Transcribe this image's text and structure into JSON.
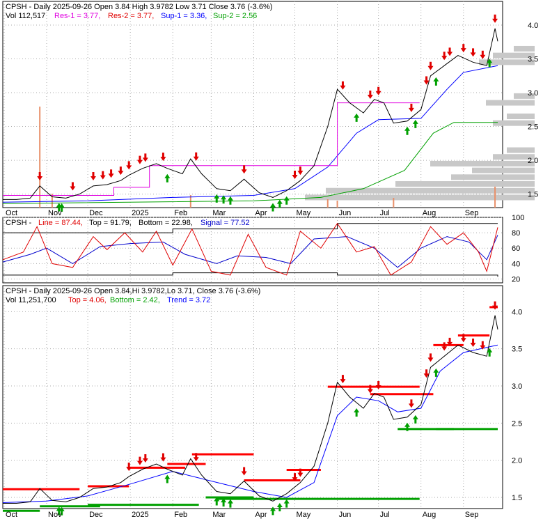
{
  "chart_data": [
    {
      "type": "candlestick",
      "symbol": "CPSH",
      "header": {
        "title": "CPSH - Daily 2025-09-26 Open 3.84  High 3.9782  Low 3.71  Close 3.76 (-3.6%)",
        "vol": "Vol 112,517",
        "res1": "Res-1 = 3.77,",
        "res2": "Res-2 = 3.77,",
        "sup1": "Sup-1 = 3.36,",
        "sup2": "Sup-2 = 2.56"
      },
      "ylim": [
        1.3,
        4.35
      ],
      "yticks": [
        "1.5",
        "2.0",
        "2.5",
        "3.0",
        "3.5",
        "4.0"
      ],
      "months": [
        "Oct",
        "Nov",
        "Dec",
        "2025",
        "Feb",
        "Mar",
        "Apr",
        "May",
        "Jun",
        "Jul",
        "Aug",
        "Sep"
      ],
      "close_path": [
        [
          "2024-09-30",
          1.42
        ],
        [
          "2024-10-10",
          1.42
        ],
        [
          "2024-10-20",
          1.44
        ],
        [
          "2024-10-27",
          1.62
        ],
        [
          "2024-11-05",
          1.46
        ],
        [
          "2024-11-15",
          1.44
        ],
        [
          "2024-11-25",
          1.5
        ],
        [
          "2024-12-05",
          1.62
        ],
        [
          "2024-12-15",
          1.64
        ],
        [
          "2024-12-25",
          1.7
        ],
        [
          "2024-12-31",
          1.78
        ],
        [
          "2025-01-10",
          1.88
        ],
        [
          "2025-01-20",
          1.95
        ],
        [
          "2025-01-28",
          1.88
        ],
        [
          "2025-02-08",
          1.8
        ],
        [
          "2025-02-14",
          2.02
        ],
        [
          "2025-02-22",
          1.8
        ],
        [
          "2025-03-05",
          1.58
        ],
        [
          "2025-03-15",
          1.55
        ],
        [
          "2025-03-25",
          1.72
        ],
        [
          "2025-04-05",
          1.52
        ],
        [
          "2025-04-15",
          1.45
        ],
        [
          "2025-04-25",
          1.55
        ],
        [
          "2025-05-05",
          1.7
        ],
        [
          "2025-05-15",
          1.92
        ],
        [
          "2025-05-25",
          2.5
        ],
        [
          "2025-06-01",
          3.05
        ],
        [
          "2025-06-10",
          2.85
        ],
        [
          "2025-06-20",
          2.7
        ],
        [
          "2025-06-28",
          2.9
        ],
        [
          "2025-07-05",
          2.85
        ],
        [
          "2025-07-12",
          2.55
        ],
        [
          "2025-07-22",
          2.58
        ],
        [
          "2025-08-01",
          2.75
        ],
        [
          "2025-08-08",
          3.25
        ],
        [
          "2025-08-18",
          3.4
        ],
        [
          "2025-08-28",
          3.55
        ],
        [
          "2025-09-08",
          3.45
        ],
        [
          "2025-09-18",
          3.4
        ],
        [
          "2025-09-24",
          3.95
        ],
        [
          "2025-09-26",
          3.76
        ]
      ],
      "ma_fast": [
        [
          "2024-09-30",
          1.43
        ],
        [
          "2024-11-01",
          1.45
        ],
        [
          "2024-12-01",
          1.52
        ],
        [
          "2025-01-01",
          1.68
        ],
        [
          "2025-02-01",
          1.85
        ],
        [
          "2025-03-01",
          1.72
        ],
        [
          "2025-04-01",
          1.58
        ],
        [
          "2025-04-25",
          1.5
        ],
        [
          "2025-05-15",
          1.7
        ],
        [
          "2025-06-01",
          2.6
        ],
        [
          "2025-06-15",
          2.85
        ],
        [
          "2025-07-01",
          2.8
        ],
        [
          "2025-07-15",
          2.65
        ],
        [
          "2025-08-01",
          2.7
        ],
        [
          "2025-08-15",
          3.2
        ],
        [
          "2025-09-01",
          3.45
        ],
        [
          "2025-09-26",
          3.55
        ]
      ],
      "ma_slow": [
        [
          "2024-09-30",
          1.38
        ],
        [
          "2024-12-01",
          1.4
        ],
        [
          "2025-02-01",
          1.45
        ],
        [
          "2025-04-01",
          1.48
        ],
        [
          "2025-05-01",
          1.58
        ],
        [
          "2025-05-25",
          1.9
        ],
        [
          "2025-06-15",
          2.4
        ],
        [
          "2025-07-01",
          2.6
        ],
        [
          "2025-08-01",
          2.62
        ],
        [
          "2025-08-20",
          3.05
        ],
        [
          "2025-09-01",
          3.3
        ],
        [
          "2025-09-26",
          3.4
        ]
      ],
      "ma_long": [
        [
          "2024-09-30",
          1.36
        ],
        [
          "2025-04-01",
          1.4
        ],
        [
          "2025-05-20",
          1.45
        ],
        [
          "2025-06-20",
          1.58
        ],
        [
          "2025-07-20",
          1.85
        ],
        [
          "2025-08-10",
          2.4
        ],
        [
          "2025-08-25",
          2.56
        ],
        [
          "2025-09-26",
          2.56
        ]
      ],
      "res_steps": [
        [
          "2024-09-30",
          1.48
        ],
        [
          "2024-11-20",
          1.48
        ],
        [
          "2024-12-20",
          1.6
        ],
        [
          "2025-01-15",
          1.92
        ],
        [
          "2025-03-01",
          1.92
        ],
        [
          "2025-03-15",
          1.92
        ],
        [
          "2025-05-01",
          1.92
        ],
        [
          "2025-06-01",
          2.85
        ],
        [
          "2025-07-31",
          2.85
        ]
      ],
      "volume_spike_dates": [
        "2024-10-27",
        "2024-11-05",
        "2025-02-14",
        "2025-05-25",
        "2025-06-01",
        "2025-07-12",
        "2025-09-24"
      ],
      "red_arrow_dates": [
        "2024-10-27",
        "2024-11-20",
        "2024-12-05",
        "2024-12-12",
        "2024-12-18",
        "2024-12-25",
        "2024-12-31",
        "2025-01-08",
        "2025-01-12",
        "2025-01-25",
        "2025-02-18",
        "2025-03-25",
        "2025-05-01",
        "2025-05-05",
        "2025-06-05",
        "2025-06-25",
        "2025-07-01",
        "2025-07-25",
        "2025-08-05",
        "2025-08-08",
        "2025-08-18",
        "2025-08-22",
        "2025-09-01",
        "2025-09-08",
        "2025-09-15",
        "2025-09-24"
      ],
      "green_arrow_dates": [
        "2024-11-10",
        "2024-11-12",
        "2025-01-28",
        "2025-03-05",
        "2025-03-10",
        "2025-03-15",
        "2025-04-15",
        "2025-04-20",
        "2025-04-25",
        "2025-06-15",
        "2025-07-22",
        "2025-07-28",
        "2025-08-12",
        "2025-09-20"
      ]
    },
    {
      "type": "line",
      "header": {
        "title": "CPSH -",
        "line": "Line = 87.44,",
        "top": "Top = 91.79,",
        "bottom": "Bottom = 22.98,",
        "signal": "Signal = 77.52"
      },
      "ylim": [
        15,
        100
      ],
      "yticks": [
        "20",
        "40",
        "60",
        "80",
        "100"
      ],
      "line": [
        [
          "2024-09-30",
          45
        ],
        [
          "2024-10-15",
          55
        ],
        [
          "2024-10-25",
          88
        ],
        [
          "2024-11-05",
          40
        ],
        [
          "2024-11-20",
          35
        ],
        [
          "2024-12-05",
          75
        ],
        [
          "2024-12-15",
          58
        ],
        [
          "2024-12-28",
          80
        ],
        [
          "2025-01-10",
          55
        ],
        [
          "2025-01-20",
          82
        ],
        [
          "2025-02-01",
          38
        ],
        [
          "2025-02-15",
          85
        ],
        [
          "2025-03-01",
          30
        ],
        [
          "2025-03-15",
          25
        ],
        [
          "2025-03-28",
          78
        ],
        [
          "2025-04-10",
          35
        ],
        [
          "2025-04-25",
          25
        ],
        [
          "2025-05-05",
          82
        ],
        [
          "2025-05-20",
          60
        ],
        [
          "2025-06-01",
          92
        ],
        [
          "2025-06-15",
          55
        ],
        [
          "2025-06-28",
          62
        ],
        [
          "2025-07-10",
          25
        ],
        [
          "2025-07-25",
          42
        ],
        [
          "2025-08-08",
          88
        ],
        [
          "2025-08-20",
          65
        ],
        [
          "2025-09-01",
          80
        ],
        [
          "2025-09-12",
          55
        ],
        [
          "2025-09-18",
          30
        ],
        [
          "2025-09-26",
          87
        ]
      ],
      "signal": [
        [
          "2024-09-30",
          42
        ],
        [
          "2024-10-20",
          52
        ],
        [
          "2024-11-01",
          60
        ],
        [
          "2024-11-20",
          40
        ],
        [
          "2024-12-10",
          62
        ],
        [
          "2025-01-01",
          66
        ],
        [
          "2025-01-25",
          68
        ],
        [
          "2025-02-10",
          52
        ],
        [
          "2025-03-05",
          40
        ],
        [
          "2025-03-20",
          50
        ],
        [
          "2025-04-10",
          48
        ],
        [
          "2025-04-28",
          40
        ],
        [
          "2025-05-15",
          72
        ],
        [
          "2025-06-08",
          75
        ],
        [
          "2025-06-28",
          60
        ],
        [
          "2025-07-15",
          35
        ],
        [
          "2025-08-01",
          60
        ],
        [
          "2025-08-20",
          75
        ],
        [
          "2025-09-05",
          68
        ],
        [
          "2025-09-18",
          45
        ],
        [
          "2025-09-26",
          77
        ]
      ],
      "top_band": [
        [
          "2024-09-30",
          80
        ],
        [
          "2025-02-01",
          85
        ],
        [
          "2025-06-01",
          92
        ],
        [
          "2025-09-26",
          92
        ]
      ],
      "bottom_band": [
        [
          "2024-09-30",
          25
        ],
        [
          "2025-02-01",
          28
        ],
        [
          "2025-06-01",
          25
        ],
        [
          "2025-09-26",
          23
        ]
      ]
    },
    {
      "type": "candlestick",
      "header": {
        "title": "CPSH - Daily 2025-09-26 Open 3.84,Hi 3.9782,Lo 3.71, Close 3.76 (-3.6%)",
        "vol": "Vol 11,251,700",
        "top": "Top = 4.06,",
        "bottom": "Bottom = 2.42,",
        "trend": "Trend = 3.72"
      },
      "ylim": [
        1.35,
        4.35
      ],
      "yticks": [
        "1.5",
        "2.0",
        "2.5",
        "3.0",
        "3.5",
        "4.0"
      ],
      "months": [
        "Oct",
        "Nov",
        "Dec",
        "2025",
        "Feb",
        "Mar",
        "Apr",
        "May",
        "Jun",
        "Jul",
        "Aug",
        "Sep"
      ],
      "red_levels": [
        [
          "2024-09-30",
          "2024-11-25",
          1.61
        ],
        [
          "2024-12-01",
          "2024-12-31",
          1.65
        ],
        [
          "2024-12-31",
          "2025-02-10",
          1.9
        ],
        [
          "2025-01-28",
          "2025-02-25",
          1.95
        ],
        [
          "2025-02-15",
          "2025-04-01",
          2.08
        ],
        [
          "2025-03-25",
          "2025-05-05",
          1.73
        ],
        [
          "2025-04-25",
          "2025-05-20",
          1.87
        ],
        [
          "2025-05-25",
          "2025-07-31",
          2.99
        ],
        [
          "2025-06-25",
          "2025-08-10",
          2.89
        ],
        [
          "2025-08-10",
          "2025-09-01",
          3.55
        ],
        [
          "2025-08-28",
          "2025-09-20",
          3.68
        ],
        [
          "2025-09-20",
          "2025-09-26",
          4.06
        ]
      ],
      "green_levels": [
        [
          "2024-09-30",
          "2024-10-27",
          1.32
        ],
        [
          "2024-10-27",
          "2024-12-10",
          1.38
        ],
        [
          "2024-12-01",
          "2025-02-20",
          1.4
        ],
        [
          "2025-02-25",
          "2025-04-01",
          1.5
        ],
        [
          "2025-03-05",
          "2025-07-31",
          1.48
        ],
        [
          "2025-07-15",
          "2025-08-25",
          2.42
        ],
        [
          "2025-08-12",
          "2025-09-26",
          2.42
        ]
      ]
    }
  ]
}
